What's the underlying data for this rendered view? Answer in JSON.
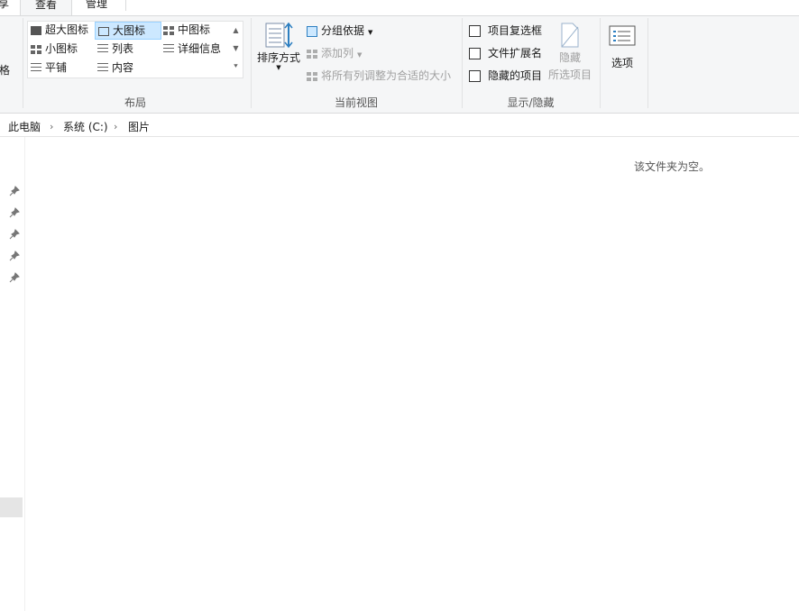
{
  "tabs": {
    "share_partial": "享",
    "view": "查看",
    "manage": "管理"
  },
  "ribbon": {
    "panes_partial": "格",
    "layout": {
      "extra_large": "超大图标",
      "large": "大图标",
      "medium": "中图标",
      "small": "小图标",
      "list": "列表",
      "details": "详细信息",
      "tiles": "平铺",
      "content": "内容",
      "group_label": "布局"
    },
    "current_view": {
      "sort_by": "排序方式",
      "group_by": "分组依据",
      "add_columns": "添加列",
      "size_columns": "将所有列调整为合适的大小",
      "group_label": "当前视图"
    },
    "show_hide": {
      "item_checkboxes": "项目复选框",
      "file_extensions": "文件扩展名",
      "hidden_items": "隐藏的项目",
      "hide_selected_line1": "隐藏",
      "hide_selected_line2": "所选项目",
      "group_label": "显示/隐藏"
    },
    "options": "选项"
  },
  "address": {
    "crumbs": [
      "此电脑",
      "系统 (C:)",
      "图片"
    ]
  },
  "content": {
    "empty_message": "该文件夹为空。"
  }
}
